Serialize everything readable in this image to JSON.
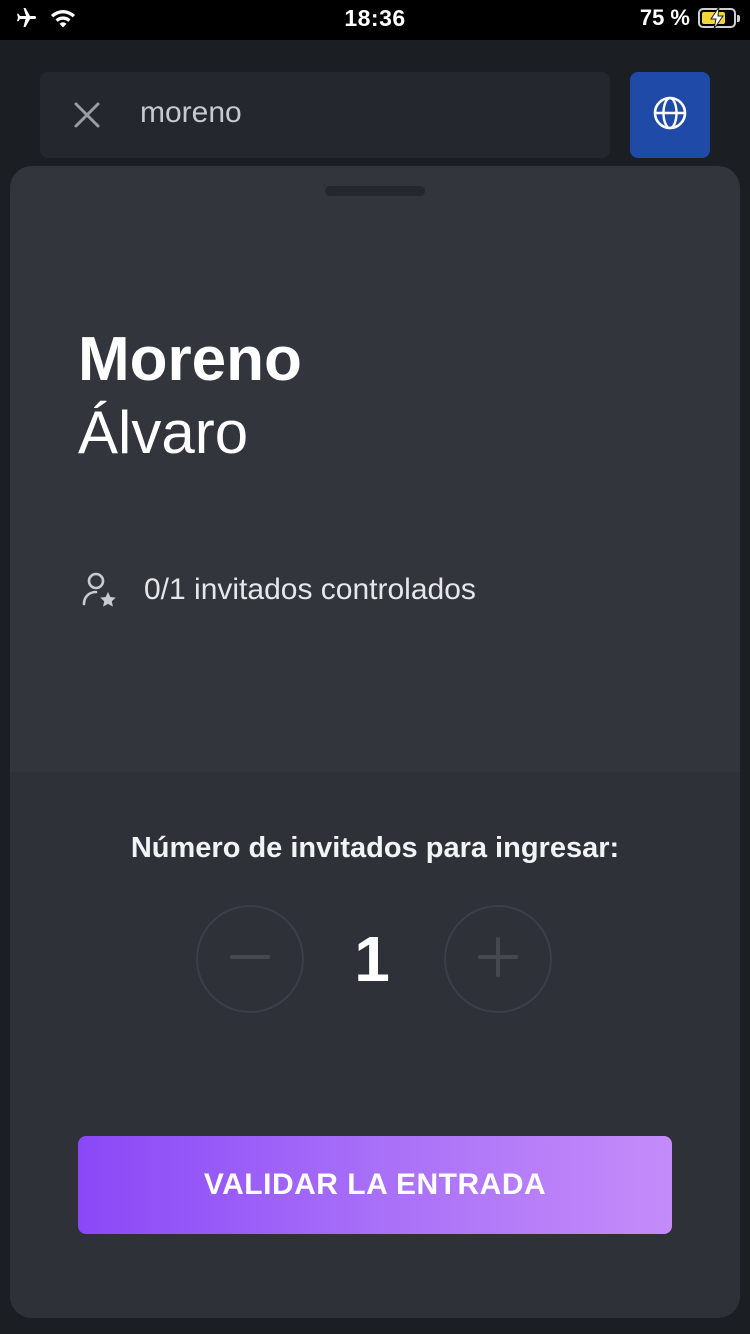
{
  "status_bar": {
    "time": "18:36",
    "battery_percent": "75 %",
    "battery_level": 0.75,
    "icons": [
      "airplane-icon",
      "wifi-icon",
      "battery-charging-icon"
    ]
  },
  "search": {
    "value": "moreno",
    "clear_icon": "close-icon",
    "language_icon": "globe-icon"
  },
  "guest": {
    "last_name": "Moreno",
    "first_name": "Álvaro",
    "invited_status": "0/1 invitados controlados",
    "status_icon": "user-star-icon"
  },
  "counter": {
    "label": "Número de invitados para ingresar:",
    "value": "1",
    "decrement_icon": "minus-icon",
    "increment_icon": "plus-icon"
  },
  "actions": {
    "validate_label": "VALIDAR LA ENTRADA"
  },
  "colors": {
    "accent_start": "#8a48f7",
    "accent_end": "#c48cf9",
    "globe_button": "#1f4aa8",
    "sheet": "#32353c"
  }
}
